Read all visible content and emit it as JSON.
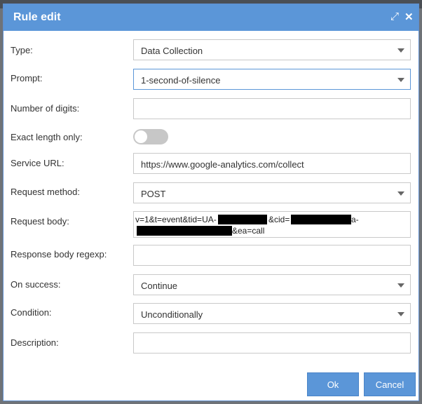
{
  "dialog": {
    "title": "Rule edit",
    "expand_icon": "expand-arrows-icon",
    "close_icon": "close-icon"
  },
  "fields": {
    "type": {
      "label": "Type:",
      "value": "Data Collection"
    },
    "prompt": {
      "label": "Prompt:",
      "value": "1-second-of-silence"
    },
    "digits": {
      "label": "Number of digits:",
      "value": ""
    },
    "exact_length": {
      "label": "Exact length only:",
      "checked": false
    },
    "service_url": {
      "label": "Service URL:",
      "value": "https://www.google-analytics.com/collect"
    },
    "request_method": {
      "label": "Request method:",
      "value": "POST"
    },
    "request_body": {
      "label": "Request body:",
      "line1_a": "v=1&t=event&tid=UA-",
      "line1_b": "&cid=",
      "line1_c": "a-",
      "line2_a": "&ea=call"
    },
    "response_regexp": {
      "label": "Response body regexp:",
      "value": ""
    },
    "on_success": {
      "label": "On success:",
      "value": "Continue"
    },
    "condition": {
      "label": "Condition:",
      "value": "Unconditionally"
    },
    "description": {
      "label": "Description:",
      "value": ""
    }
  },
  "buttons": {
    "ok": "Ok",
    "cancel": "Cancel"
  },
  "colors": {
    "accent": "#5b96d8",
    "toggle_off": "#c7c7c7"
  }
}
